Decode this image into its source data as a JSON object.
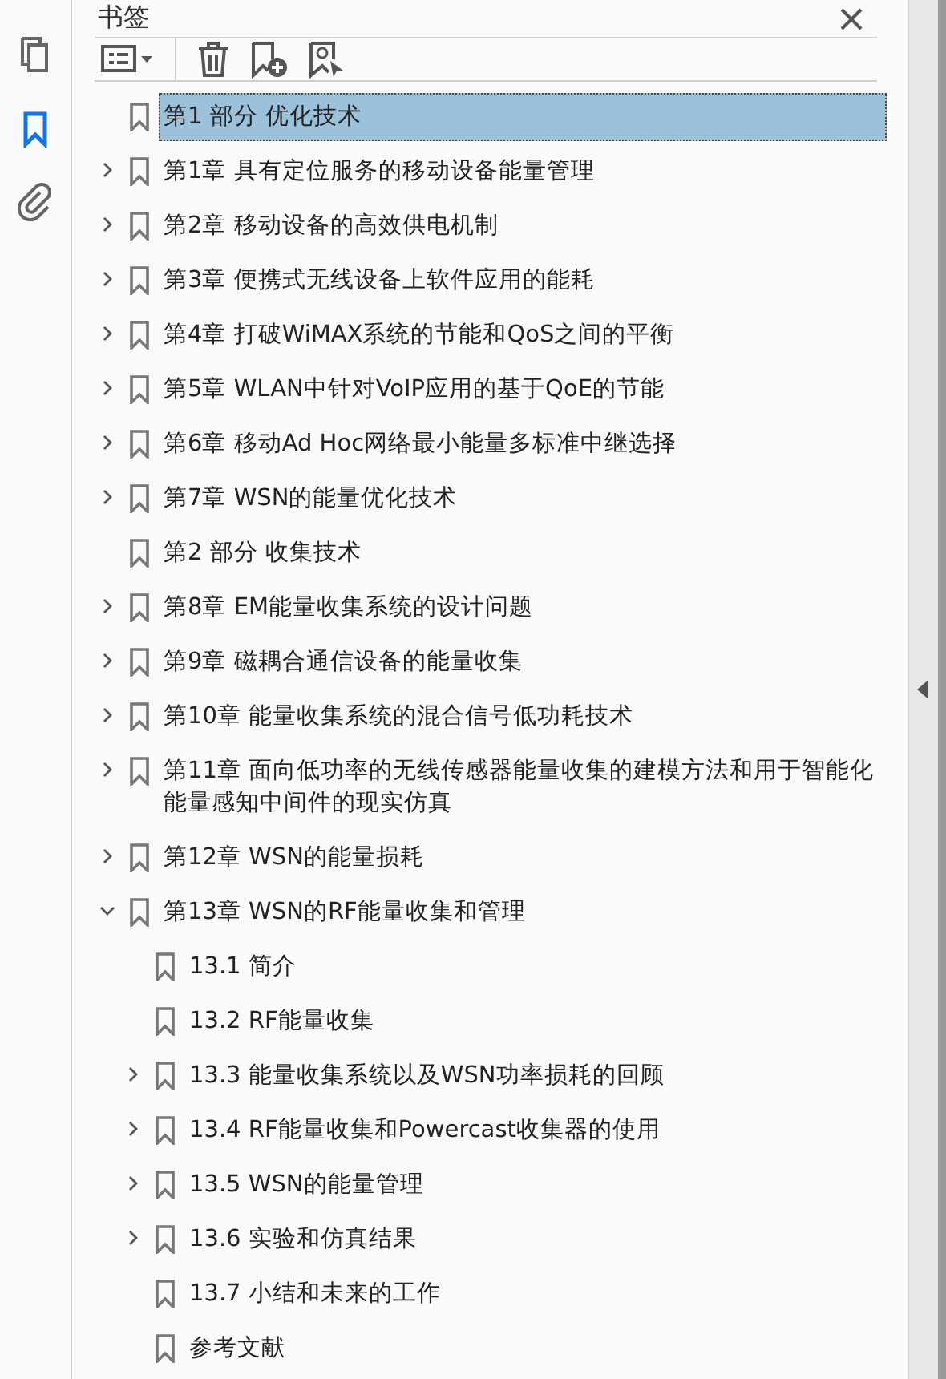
{
  "rail": [
    {
      "kind": "pages",
      "selected": false
    },
    {
      "kind": "bookmarks",
      "selected": true
    },
    {
      "kind": "attachments",
      "selected": false
    }
  ],
  "panel": {
    "title": "书签"
  },
  "bookmarks": [
    {
      "label": "第1 部分 优化技术",
      "selected": true
    },
    {
      "label": "第1章 具有定位服务的移动设备能量管理",
      "selected": false,
      "expanded": false
    },
    {
      "label": "第2章 移动设备的高效供电机制",
      "selected": false,
      "expanded": false
    },
    {
      "label": "第3章 便携式无线设备上软件应用的能耗",
      "selected": false,
      "expanded": false
    },
    {
      "label": "第4章 打破WiMAX系统的节能和QoS之间的平衡",
      "selected": false,
      "expanded": false
    },
    {
      "label": "第5章 WLAN中针对VoIP应用的基于QoE的节能",
      "selected": false,
      "expanded": false
    },
    {
      "label": "第6章 移动Ad Hoc网络最小能量多标准中继选择",
      "selected": false,
      "expanded": false
    },
    {
      "label": "第7章 WSN的能量优化技术",
      "selected": false,
      "expanded": false
    },
    {
      "label": "第2 部分 收集技术",
      "selected": false
    },
    {
      "label": "第8章 EM能量收集系统的设计问题",
      "selected": false,
      "expanded": false
    },
    {
      "label": "第9章 磁耦合通信设备的能量收集",
      "selected": false,
      "expanded": false
    },
    {
      "label": "第10章 能量收集系统的混合信号低功耗技术",
      "selected": false,
      "expanded": false
    },
    {
      "label": "第11章 面向低功率的无线传感器能量收集的建模方法和用于智能化能量感知中间件的现实仿真",
      "selected": false,
      "expanded": false
    },
    {
      "label": "第12章 WSN的能量损耗",
      "selected": false,
      "expanded": false
    },
    {
      "label": "第13章 WSN的RF能量收集和管理",
      "selected": false,
      "expanded": true,
      "children": [
        {
          "label": "13.1 简介",
          "selected": false
        },
        {
          "label": "13.2 RF能量收集",
          "selected": false
        },
        {
          "label": "13.3 能量收集系统以及WSN功率损耗的回顾",
          "selected": false,
          "expanded": false
        },
        {
          "label": "13.4 RF能量收集和Powercast收集器的使用",
          "selected": false,
          "expanded": false
        },
        {
          "label": "13.5 WSN的能量管理",
          "selected": false,
          "expanded": false
        },
        {
          "label": "13.6 实验和仿真结果",
          "selected": false,
          "expanded": false
        },
        {
          "label": "13.7 小结和未来的工作",
          "selected": false
        },
        {
          "label": "参考文献",
          "selected": false
        }
      ]
    }
  ]
}
